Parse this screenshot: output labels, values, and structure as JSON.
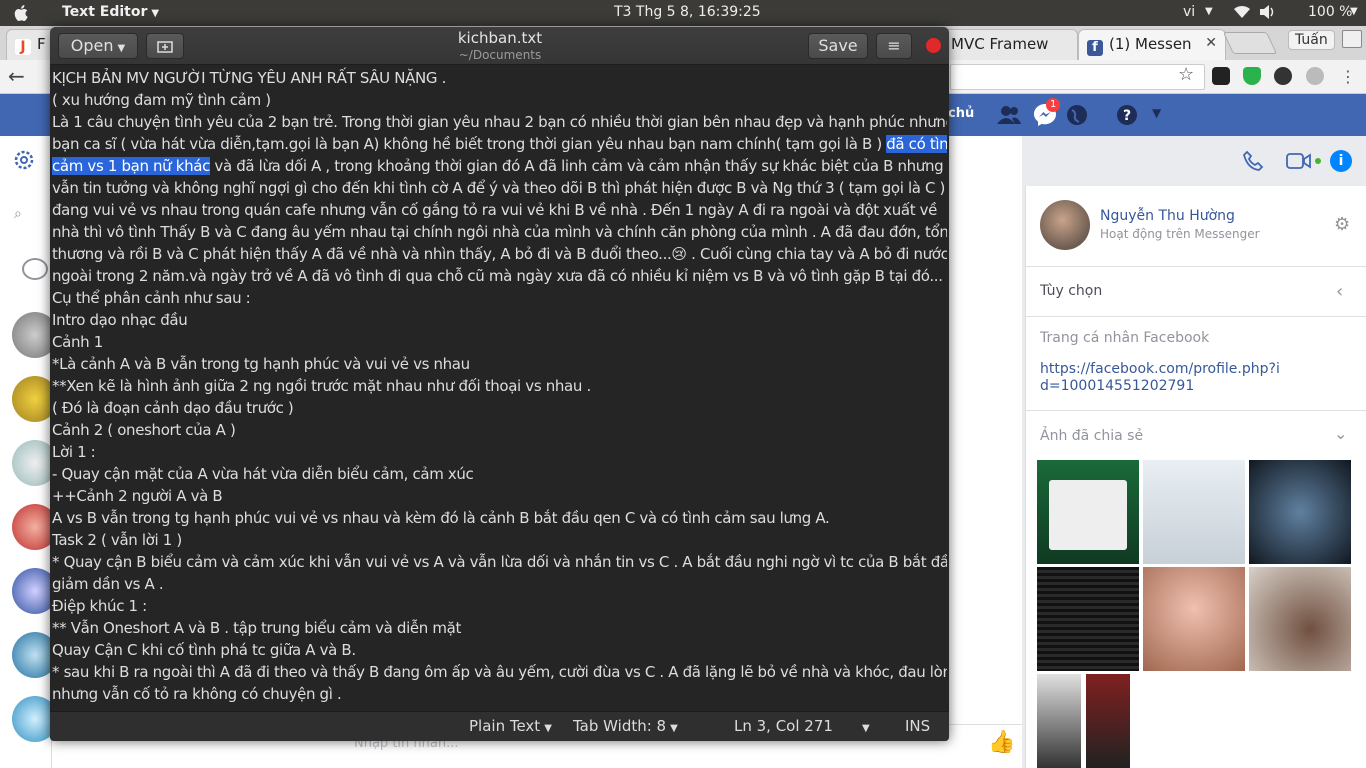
{
  "system_bar": {
    "app_name": "Text Editor",
    "clock": "T3 Thg 5  8, 16:39:25",
    "language": "vi",
    "battery": "100 %"
  },
  "browser": {
    "tabs": [
      {
        "label": "F",
        "favicon_color": "#e34c26"
      },
      {
        "label": "MVC Framew",
        "favicon_color": "#e34c26"
      },
      {
        "label": "(1) Messen",
        "favicon_color": "#3b5998"
      }
    ],
    "profile_name": "Tuấn"
  },
  "facebook": {
    "nav_home": "chủ",
    "notification_count": "1",
    "contact": {
      "name": "Nguyễn Thu Hường",
      "status": "Hoạt động trên Messenger"
    },
    "options_label": "Tùy chọn",
    "profile_section_label": "Trang cá nhân Facebook",
    "profile_url": "https://facebook.com/profile.php?id=100014551202791",
    "shared_photos_label": "Ảnh đã chia sẻ",
    "message_placeholder": "Nhập tin nhắn..."
  },
  "editor": {
    "open_label": "Open",
    "save_label": "Save",
    "file_name": "kichban.txt",
    "file_path": "~/Documents",
    "status": {
      "language": "Plain Text",
      "tab_width": "Tab Width: 8",
      "cursor": "Ln 3, Col 271",
      "mode": "INS"
    },
    "lines": [
      {
        "text": "KỊCH BẢN MV NGƯỜI TỪNG YÊU ANH RẤT SÂU NẶNG ."
      },
      {
        "text": "( xu hướng đam mỹ tình cảm )"
      },
      {
        "text": "Là 1 câu chuyện tình yêu của 2 bạn trẻ. Trong thời gian yêu nhau 2 bạn có nhiều thời gian bên nhau đẹp và hạnh phúc nhưng"
      },
      {
        "text": "bạn ca sĩ ( vừa hát vừa diễn,tạm.gọi là bạn A) không hề biết trong thời gian yêu nhau bạn nam chính( tạm gọi là B ) ",
        "sel": "đã có tình"
      },
      {
        "sel": "cảm vs 1 bạn nữ khác",
        "text": " và đã lừa dối A , trong khoảng thời gian đó A đã linh cảm và cảm nhận thấy sự khác biệt của B nhưng"
      },
      {
        "text": "vẫn tin tưởng và không nghĩ ngợi gì cho đến khi tình cờ A để ý và theo dõi B thì phát hiện được B và Ng thứ 3 ( tạm gọi là C )"
      },
      {
        "text": "đang vui vẻ vs nhau trong quán cafe nhưng vẫn cố gắng tỏ ra vui vẻ khi B về nhà . Đến 1 ngày A đi ra ngoài và đột xuất về"
      },
      {
        "text": "nhà thì vô tình Thấy B và C đang âu yếm nhau tại chính ngôi nhà của mình và chính căn phòng của mình . A đã đau đớn,  tổn"
      },
      {
        "text": "thương và rồi B và C phát hiện thấy A đã về nhà và nhìn thấy, A bỏ đi và B đuổi theo...😢 . Cuối cùng chia tay và A bỏ đi nước"
      },
      {
        "text": "ngoài trong 2 năm.và ngày trở về A đã vô tình đi qua chỗ cũ  mà ngày xưa đã có nhiều kỉ niệm vs B và vô tình gặp B tại đó..."
      },
      {
        "text": "Cụ thể phân cảnh như sau :"
      },
      {
        "text": "Intro dạo nhạc đầu"
      },
      {
        "text": "Cảnh 1"
      },
      {
        "text": "*Là cảnh A và B vẫn trong tg hạnh phúc và vui vẻ vs nhau"
      },
      {
        "text": "**Xen kẽ là hình ảnh giữa 2 ng ngồi trước mặt nhau như đối thoại vs nhau ."
      },
      {
        "text": "( Đó là đoạn cảnh dạo đầu trước )"
      },
      {
        "text": "Cảnh 2 ( oneshort của A )"
      },
      {
        "text": "Lời 1 :"
      },
      {
        "text": "- Quay cận mặt của A vừa hát vừa diễn biểu cảm,  cảm xúc"
      },
      {
        "text": "++Cảnh 2 người A và B"
      },
      {
        "text": " A vs B vẫn trong tg hạnh phúc vui vẻ vs nhau và kèm đó là cảnh B bắt đầu qen C và có tình cảm sau lưng A."
      },
      {
        "text": "Task 2 ( vẫn lời 1 )"
      },
      {
        "text": "* Quay cận B biểu cảm và cảm xúc khi vẫn vui vẻ vs A và vẫn lừa dối và nhắn tin vs C . A bắt đầu nghi ngờ vì tc của B bắt đầu"
      },
      {
        "text": "giảm dần vs A ."
      },
      {
        "text": "Điệp khúc 1 :"
      },
      {
        "text": "** Vẫn Oneshort A và B . tập trung biểu cảm và diễn mặt"
      },
      {
        "text": "Quay Cận C khi cố tình phá tc giữa A và B."
      },
      {
        "text": "* sau khi B ra ngoài thì A đã đi theo và thấy B đang ôm ấp và âu yếm, cười đùa vs C . A đã lặng lẽ bỏ về nhà và khóc, đau lòng"
      },
      {
        "text": "nhưng vẫn cố tỏ ra không có chuyện gì ."
      }
    ]
  },
  "colors": {
    "facebook_blue": "#4267b2",
    "selection": "#2a66d9",
    "editor_bg": "#252525"
  }
}
